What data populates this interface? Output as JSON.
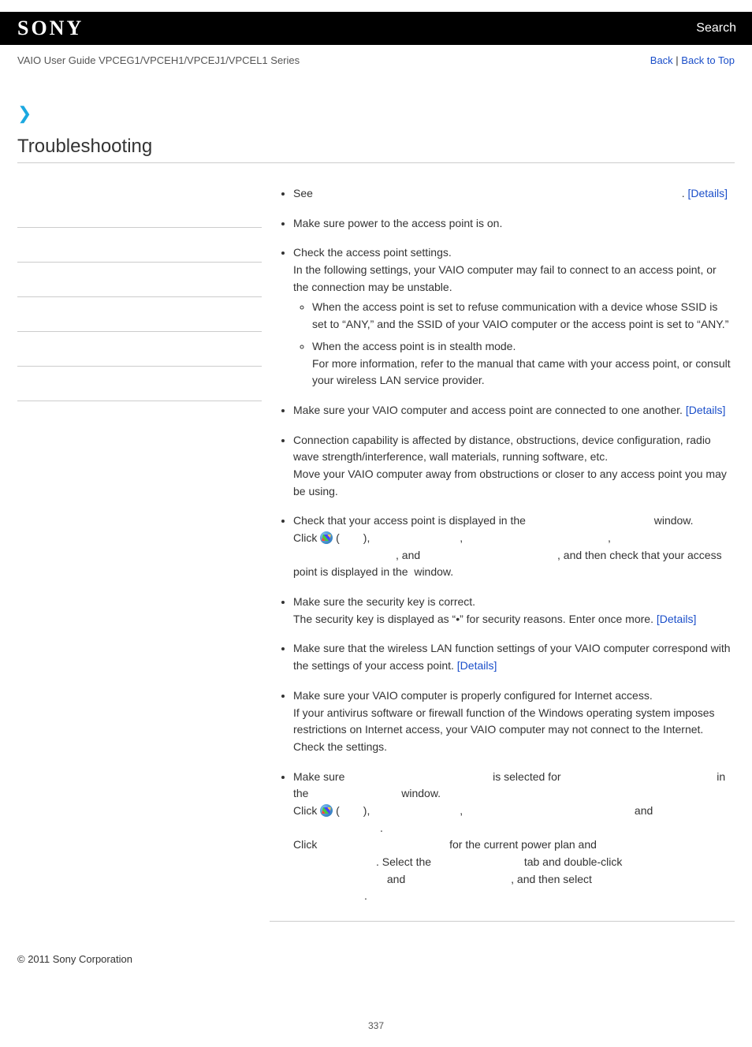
{
  "header": {
    "brand": "SONY",
    "search": "Search"
  },
  "subheader": {
    "breadcrumb": "VAIO User Guide VPCEG1/VPCEH1/VPCEJ1/VPCEL1 Series",
    "back": "Back",
    "back_to_top": "Back to Top",
    "sep": " | "
  },
  "title": "Troubleshooting",
  "bullets": {
    "b1_see": "See ",
    "b1_dot": ". ",
    "b1_details": "[Details]",
    "b2": "Make sure power to the access point is on.",
    "b3_a": "Check the access point settings.",
    "b3_b": "In the following settings, your VAIO computer may fail to connect to an access point, or the connection may be unstable.",
    "b3_s1": "When the access point is set to refuse communication with a device whose SSID is set to “ANY,” and the SSID of your VAIO computer or the access point is set to “ANY.”",
    "b3_s2a": "When the access point is in stealth mode.",
    "b3_s2b": "For more information, refer to the manual that came with your access point, or consult your wireless LAN service provider.",
    "b4_a": "Make sure your VAIO computer and access point are connected to one another. ",
    "b4_details": "[Details]",
    "b5_a": "Connection capability is affected by distance, obstructions, device configuration, radio wave strength/interference, wall materials, running software, etc.",
    "b5_b": "Move your VAIO computer away from obstructions or closer to any access point you may be using.",
    "b6_a": "Check that your access point is displayed in the ",
    "b6_window": " window.",
    "b6_click": "Click ",
    "b6_paren_open": " (",
    "b6_paren_close": "), ",
    "b6_comma": ", ",
    "b6_and": ", and ",
    "b6_then": ", and then check that your access point is displayed in the ",
    "b6_window2": " window.",
    "b7_a": "Make sure the security key is correct.",
    "b7_b": "The security key is displayed as “•” for security reasons. Enter once more. ",
    "b7_details": "[Details]",
    "b8_a": "Make sure that the wireless LAN function settings of your VAIO computer correspond with the settings of your access point. ",
    "b8_details": "[Details]",
    "b9_a": "Make sure your VAIO computer is properly configured for Internet access.",
    "b9_b": "If your antivirus software or firewall function of the Windows operating system imposes restrictions on Internet access, your VAIO computer may not connect to the Internet. Check the settings.",
    "b10_a": "Make sure ",
    "b10_b": " is selected for ",
    "b10_c": " in the ",
    "b10_d": " window.",
    "b10_click": "Click ",
    "b10_po": " (",
    "b10_pc": "), ",
    "b10_comma": ", ",
    "b10_and": " and ",
    "b10_dot": ".",
    "b10_e": "Click ",
    "b10_f": " for the current power plan and ",
    "b10_g": ". Select the ",
    "b10_h": " tab and double-click ",
    "b10_i": " and ",
    "b10_j": ", and then select ",
    "b10_k": "."
  },
  "copyright": "© 2011 Sony Corporation",
  "page_number": "337"
}
